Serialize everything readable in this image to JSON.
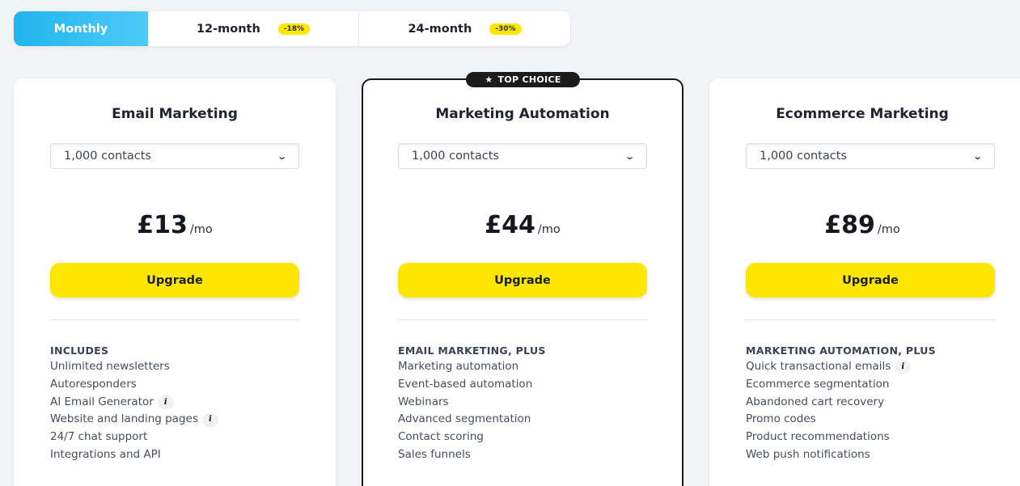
{
  "billing": {
    "tabs": [
      {
        "label": "Monthly",
        "badge": ""
      },
      {
        "label": "12-month",
        "badge": "-18%"
      },
      {
        "label": "24-month",
        "badge": "-30%"
      }
    ],
    "selected": "Monthly"
  },
  "plans": [
    {
      "name": "Email Marketing",
      "contacts": "1,000 contacts",
      "price": "£13",
      "per": "/mo",
      "cta": "Upgrade",
      "features_header": "INCLUDES",
      "features": [
        {
          "label": "Unlimited newsletters",
          "info": false
        },
        {
          "label": "Autoresponders",
          "info": false
        },
        {
          "label": "AI Email Generator",
          "info": true
        },
        {
          "label": "Website and landing pages",
          "info": true
        },
        {
          "label": "24/7 chat support",
          "info": false
        },
        {
          "label": "Integrations and API",
          "info": false
        }
      ]
    },
    {
      "badge": "TOP CHOICE",
      "name": "Marketing Automation",
      "contacts": "1,000 contacts",
      "price": "£44",
      "per": "/mo",
      "cta": "Upgrade",
      "features_header": "EMAIL MARKETING, PLUS",
      "features": [
        {
          "label": "Marketing automation",
          "info": false
        },
        {
          "label": "Event-based automation",
          "info": false
        },
        {
          "label": "Webinars",
          "info": false
        },
        {
          "label": "Advanced segmentation",
          "info": false
        },
        {
          "label": "Contact scoring",
          "info": false
        },
        {
          "label": "Sales funnels",
          "info": false
        }
      ]
    },
    {
      "name": "Ecommerce Marketing",
      "contacts": "1,000 contacts",
      "price": "£89",
      "per": "/mo",
      "cta": "Upgrade",
      "features_header": "MARKETING AUTOMATION, PLUS",
      "features": [
        {
          "label": "Quick transactional emails",
          "info": true
        },
        {
          "label": "Ecommerce segmentation",
          "info": false
        },
        {
          "label": "Abandoned cart recovery",
          "info": false
        },
        {
          "label": "Promo codes",
          "info": false
        },
        {
          "label": "Product recommendations",
          "info": false
        },
        {
          "label": "Web push notifications",
          "info": false
        }
      ]
    }
  ],
  "icons": {
    "info": "info-icon",
    "chevron": "chevron-down-icon",
    "star": "star-icon",
    "info_glyph": "i"
  },
  "colors": {
    "accent_yellow": "#ffe600",
    "tab_active": "#21b5ee",
    "featured_border": "#1a1a1a"
  }
}
